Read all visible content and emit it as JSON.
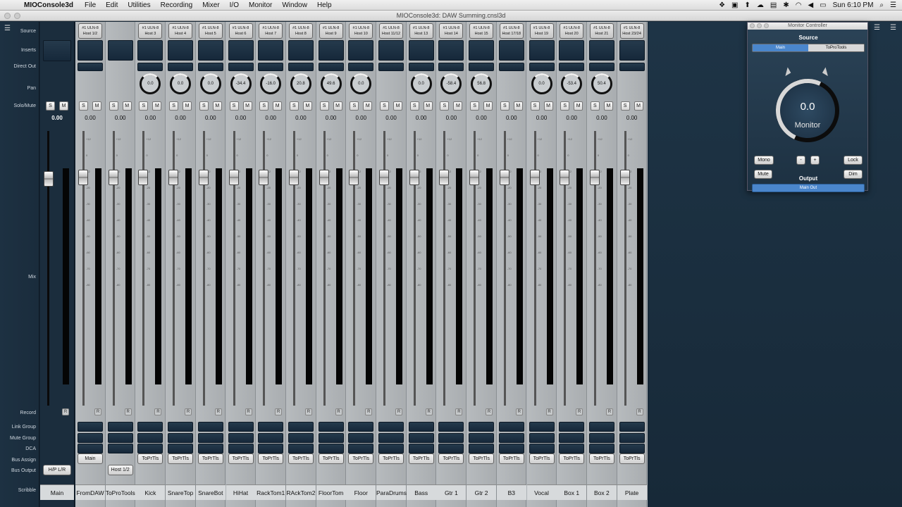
{
  "menubar": {
    "app_name": "MIOConsole3d",
    "menus": [
      "File",
      "Edit",
      "Utilities",
      "Recording",
      "Mixer",
      "I/O",
      "Monitor",
      "Window",
      "Help"
    ],
    "clock": "Sun 6:10 PM"
  },
  "window": {
    "title": "MIOConsole3d: DAW Summing.cnsl3d"
  },
  "row_labels": {
    "source": "Source",
    "inserts": "Inserts",
    "direct_out": "Direct Out",
    "pan": "Pan",
    "solo_mute": "Solo/Mute",
    "mix": "Mix",
    "record": "Record",
    "link_group": "Link Group",
    "mute_group": "Mute Group",
    "dca": "DCA",
    "bus_assign": "Bus Assign",
    "bus_output": "Bus Output",
    "scribble": "Scribble"
  },
  "main_strip": {
    "solo": "S",
    "mute": "M",
    "value": "0.00",
    "bus_output": "H/P L/R",
    "scribble": "Main"
  },
  "strips": [
    {
      "src1": "#1 ULN-8",
      "src2": "Host 1/2",
      "pan": "",
      "value": "0.00",
      "bus": "Main",
      "busout": "",
      "scribble": "FromDAW",
      "rec": "R"
    },
    {
      "src1": "",
      "src2": "",
      "pan": "",
      "value": "0.00",
      "bus": "",
      "busout": "Host 1/2",
      "scribble": "ToProTools",
      "rec": "R"
    },
    {
      "src1": "#1 ULN-8",
      "src2": "Host 3",
      "pan": "0.0",
      "value": "0.00",
      "bus": "ToPrTls",
      "busout": "",
      "scribble": "Kick",
      "rec": "R"
    },
    {
      "src1": "#1 ULN-8",
      "src2": "Host 4",
      "pan": "0.0",
      "value": "0.00",
      "bus": "ToPrTls",
      "busout": "",
      "scribble": "SnareTop",
      "rec": "R"
    },
    {
      "src1": "#1 ULN-8",
      "src2": "Host 5",
      "pan": "0.0",
      "value": "0.00",
      "bus": "ToPrTls",
      "busout": "",
      "scribble": "SnareBot",
      "rec": "R"
    },
    {
      "src1": "#1 ULN-8",
      "src2": "Host 6",
      "pan": "-34.4",
      "value": "0.00",
      "bus": "ToPrTls",
      "busout": "",
      "scribble": "HiHat",
      "rec": "R"
    },
    {
      "src1": "#1 ULN-8",
      "src2": "Host 7",
      "pan": "-16.0",
      "value": "0.00",
      "bus": "ToPrTls",
      "busout": "",
      "scribble": "RackTom1",
      "rec": "R"
    },
    {
      "src1": "#1 ULN-8",
      "src2": "Host 8",
      "pan": "20.8",
      "value": "0.00",
      "bus": "ToPrTls",
      "busout": "",
      "scribble": "RAckTom2",
      "rec": "R"
    },
    {
      "src1": "#1 ULN-8",
      "src2": "Host 9",
      "pan": "49.6",
      "value": "0.00",
      "bus": "ToPrTls",
      "busout": "",
      "scribble": "FloorTom",
      "rec": "R"
    },
    {
      "src1": "#1 ULN-8",
      "src2": "Host 10",
      "pan": "0.0",
      "value": "0.00",
      "bus": "ToPrTls",
      "busout": "",
      "scribble": "Floor",
      "rec": "R"
    },
    {
      "src1": "#1 ULN-8",
      "src2": "Host 11/12",
      "pan": "",
      "value": "0.00",
      "bus": "ToPrTls",
      "busout": "",
      "scribble": "ParaDrums",
      "rec": "R"
    },
    {
      "src1": "#1 ULN-8",
      "src2": "Host 13",
      "pan": "0.0",
      "value": "0.00",
      "bus": "ToPrTls",
      "busout": "",
      "scribble": "Bass",
      "rec": "R"
    },
    {
      "src1": "#1 ULN-8",
      "src2": "Host 14",
      "pan": "-58.4",
      "value": "0.00",
      "bus": "ToPrTls",
      "busout": "",
      "scribble": "Gtr 1",
      "rec": "R"
    },
    {
      "src1": "#1 ULN-8",
      "src2": "Host 15",
      "pan": "56.8",
      "value": "0.00",
      "bus": "ToPrTls",
      "busout": "",
      "scribble": "Gtr 2",
      "rec": "R"
    },
    {
      "src1": "#1 ULN-8",
      "src2": "Host 17/18",
      "pan": "",
      "value": "0.00",
      "bus": "ToPrTls",
      "busout": "",
      "scribble": "B3",
      "rec": "R"
    },
    {
      "src1": "#1 ULN-8",
      "src2": "Host 19",
      "pan": "0.0",
      "value": "0.00",
      "bus": "ToPrTls",
      "busout": "",
      "scribble": "Vocal",
      "rec": "R"
    },
    {
      "src1": "#1 ULN-8",
      "src2": "Host 20",
      "pan": "-53.4",
      "value": "0.00",
      "bus": "ToPrTls",
      "busout": "",
      "scribble": "Box 1",
      "rec": "R"
    },
    {
      "src1": "#1 ULN-8",
      "src2": "Host 21",
      "pan": "50.4",
      "value": "0.00",
      "bus": "ToPrTls",
      "busout": "",
      "scribble": "Box 2",
      "rec": "R"
    },
    {
      "src1": "#1 ULN-8",
      "src2": "Host 23/24",
      "pan": "",
      "value": "0.00",
      "bus": "ToPrTls",
      "busout": "",
      "scribble": "Plate",
      "rec": "R"
    }
  ],
  "monitor": {
    "title": "Monitor Controller",
    "source_label": "Source",
    "source_options": [
      "Main",
      "ToProTools"
    ],
    "value": "0.0",
    "knob_label": "Monitor",
    "mono": "Mono",
    "minus": "-",
    "plus": "+",
    "lock": "Lock",
    "mute": "Mute",
    "output_label": "Output",
    "dim": "Dim",
    "output": "Main Out"
  }
}
